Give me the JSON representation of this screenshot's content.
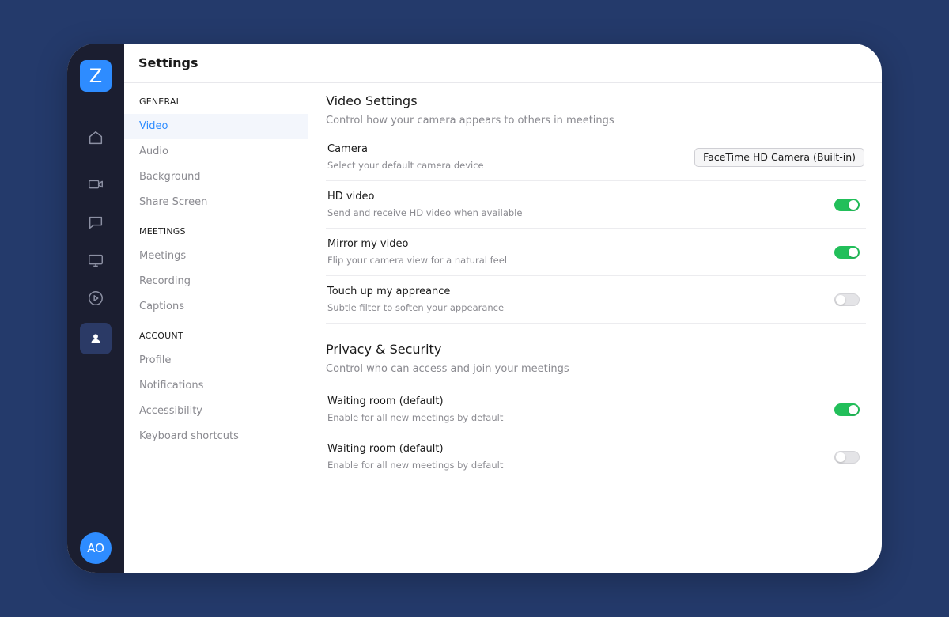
{
  "window": {
    "title": "Settings"
  },
  "rail": {
    "logo": "Z",
    "icons": [
      "home-icon",
      "video-camera-icon",
      "chat-icon",
      "monitor-icon",
      "play-icon",
      "user-icon"
    ],
    "active_icon": "user-icon",
    "avatar_initials": "AO"
  },
  "nav": {
    "sections": [
      {
        "title": "GENERAL",
        "items": [
          "Video",
          "Audio",
          "Background",
          "Share Screen"
        ]
      },
      {
        "title": "MEETINGS",
        "items": [
          "Meetings",
          "Recording",
          "Captions"
        ]
      },
      {
        "title": "ACCOUNT",
        "items": [
          "Profile",
          "Notifications",
          "Accessibility",
          "Keyboard shortcuts"
        ]
      }
    ],
    "active_item": "Video"
  },
  "video_settings": {
    "title": "Video Settings",
    "description": "Control how your camera appears to others in meetings",
    "camera": {
      "label": "Camera",
      "description": "Select your default camera device",
      "value": "FaceTime HD Camera (Built-in)"
    },
    "hd_video": {
      "label": "HD video",
      "description": "Send and receive HD video when available",
      "enabled": true
    },
    "mirror": {
      "label": "Mirror my video",
      "description": "Flip your camera view for a natural feel",
      "enabled": true
    },
    "touch_up": {
      "label": "Touch up my appreance",
      "description": "Subtle filter to soften your appearance",
      "enabled": false
    }
  },
  "privacy": {
    "title": "Privacy & Security",
    "description": "Control who can access  and join your meetings",
    "waiting_room_1": {
      "label": "Waiting room (default)",
      "description": "Enable for all new meetings by default",
      "enabled": true
    },
    "waiting_room_2": {
      "label": "Waiting room (default)",
      "description": "Enable for all new meetings by default",
      "enabled": false
    }
  },
  "colors": {
    "background": "#243a6b",
    "rail": "#1b1e30",
    "accent": "#2e8cff",
    "toggle_on": "#22bf5a",
    "toggle_off": "#e4e4e7"
  }
}
